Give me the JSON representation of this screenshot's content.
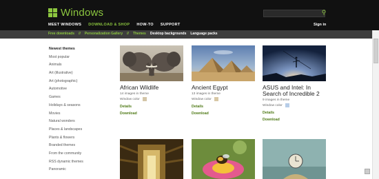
{
  "header": {
    "logo_text": "Windows",
    "nav": [
      "MEET WINDOWS",
      "DOWNLOAD & SHOP",
      "HOW-TO",
      "SUPPORT"
    ],
    "active_nav_index": 1,
    "signin": "Sign in",
    "search_placeholder": ""
  },
  "subnav": {
    "items": [
      "Free downloads",
      "Personalization Gallery",
      "Themes",
      "Desktop backgrounds",
      "Language packs"
    ],
    "separator": "//"
  },
  "sidebar": {
    "items": [
      "Newest themes",
      "Most popular",
      "Animals",
      "Art (illustrative)",
      "Art (photographic)",
      "Automotive",
      "Games",
      "Holidays & seasons",
      "Movies",
      "Natural wonders",
      "Places & landscapes",
      "Plants & flowers",
      "Branded themes",
      "From the community",
      "RSS dynamic themes",
      "Panoramic"
    ]
  },
  "themes": [
    {
      "title": "African Wildlife",
      "count": "14 images in theme",
      "color_label": "Window color",
      "swatch": "#d4c6a8",
      "details": "Details",
      "download": "Download"
    },
    {
      "title": "Ancient Egypt",
      "count": "13 images in theme",
      "color_label": "Window color",
      "swatch": "#d8c8a6",
      "details": "Details",
      "download": "Download"
    },
    {
      "title": "ASUS and Intel: In Search of Incredible 2",
      "count": "9 images in theme",
      "color_label": "Window color",
      "swatch": "#b7cde8",
      "details": "Details",
      "download": "Download"
    }
  ],
  "colors": {
    "accent": "#8cc63f",
    "link": "#4f7a16",
    "header_bg": "#111111",
    "subnav_bg": "#3d3d3d"
  }
}
